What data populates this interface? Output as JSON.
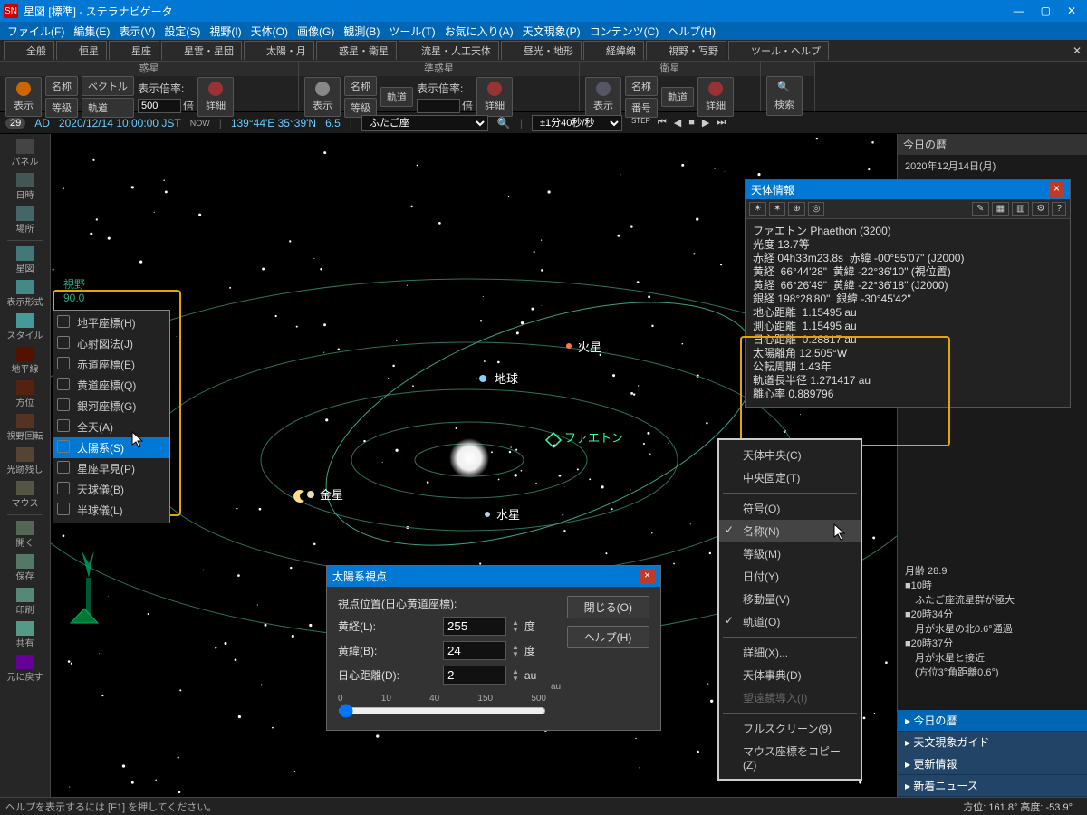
{
  "window_title": "星図 [標準] - ステラナビゲータ",
  "menus": [
    "ファイル(F)",
    "編集(E)",
    "表示(V)",
    "設定(S)",
    "視野(I)",
    "天体(O)",
    "画像(G)",
    "観測(B)",
    "ツール(T)",
    "お気に入り(A)",
    "天文現象(P)",
    "コンテンツ(C)",
    "ヘルプ(H)"
  ],
  "tabs": [
    "全般",
    "恒星",
    "星座",
    "星雲・星団",
    "太陽・月",
    "惑星・衛星",
    "流星・人工天体",
    "昼光・地形",
    "経緯線",
    "視野・写野",
    "ツール・ヘルプ"
  ],
  "tb": {
    "group1": "惑星",
    "group2": "準惑星",
    "group3": "衛星",
    "show": "表示",
    "name": "名称",
    "mag": "等級",
    "vector": "ベクトル",
    "orbit": "軌道",
    "number": "番号",
    "scale_label": "表示倍率:",
    "scale_value": "500",
    "bai": "倍",
    "detail": "詳細",
    "search": "検索"
  },
  "timebar": {
    "badge": "29",
    "ad": "AD",
    "datetime": "2020/12/14 10:00:00 JST",
    "now": "NOW",
    "lonlat": "139°44'E 35°39'N",
    "fov": "6.5",
    "constellation": "ふたご座",
    "step": "±1分40秒/秒"
  },
  "leftpanel": [
    "パネル",
    "日時",
    "場所",
    "星図",
    "表示形式",
    "スタイル",
    "地平線",
    "方位",
    "視野回転",
    "光跡残し",
    "マウス",
    "開く",
    "保存",
    "印刷",
    "共有",
    "元に戻す"
  ],
  "fov_label": "視野",
  "fov_val": "90.0",
  "coord_menu": {
    "items": [
      "地平座標(H)",
      "心射図法(J)",
      "赤道座標(E)",
      "黄道座標(Q)",
      "銀河座標(G)",
      "全天(A)",
      "太陽系(S)",
      "星座早見(P)",
      "天球儀(B)",
      "半球儀(L)"
    ],
    "selected": 6
  },
  "sky_labels": {
    "mars": "火星",
    "earth": "地球",
    "mercury": "水星",
    "venus": "金星",
    "phaethon": "ファエトン"
  },
  "info": {
    "title": "天体情報",
    "lines": [
      "ファエトン Phaethon (3200)",
      "光度 13.7等",
      "赤経 04h33m23.8s  赤緯 -00°55'07\" (J2000)",
      "黄経  66°44'28\"  黄緯 -22°36'10\" (視位置)",
      "黄経  66°26'49\"  黄緯 -22°36'18\" (J2000)",
      "銀経 198°28'80\"  銀緯 -30°45'42\"",
      "地心距離  1.15495 au",
      "測心距離  1.15495 au",
      "日心距離  0.28817 au",
      "太陽離角 12.505°W",
      "公転周期 1.43年",
      "軌道長半径 1.271417 au",
      "離心率 0.889796"
    ]
  },
  "ctx2": {
    "items": [
      "天体中央(C)",
      "中央固定(T)",
      "符号(O)",
      "名称(N)",
      "等級(M)",
      "日付(Y)",
      "移動量(V)",
      "軌道(O)",
      "詳細(X)...",
      "天体事典(D)",
      "望遠鏡導入(I)",
      "フルスクリーン(9)",
      "マウス座標をコピー(Z)"
    ],
    "checked": [
      3,
      7
    ],
    "disabled": [
      10
    ],
    "selected": 3
  },
  "dlg": {
    "title": "太陽系視点",
    "caption": "視点位置(日心黄道座標):",
    "lon_label": "黄経(L):",
    "lon": "255",
    "lon_unit": "度",
    "lat_label": "黄緯(B):",
    "lat": "24",
    "lat_unit": "度",
    "dist_label": "日心距離(D):",
    "dist": "2",
    "dist_unit": "au",
    "ticks": [
      "0",
      "10",
      "40",
      "150",
      "500"
    ],
    "tick_unit": "au",
    "close_btn": "閉じる(O)",
    "help_btn": "ヘルプ(H)"
  },
  "rcol": {
    "hdr": "今日の暦",
    "date": "2020年12月14日(月)",
    "moon_age": "月齢 28.9",
    "events": [
      "■10時",
      "　ふたご座流星群が極大",
      "■20時34分",
      "　月が水星の北0.6°通過",
      "■20時37分",
      "　月が水星と接近",
      "　(方位3°角距離0.6°)"
    ],
    "links": [
      "今日の暦",
      "天文現象ガイド",
      "更新情報",
      "新着ニュース"
    ]
  },
  "status": {
    "hint": "ヘルプを表示するには [F1] を押してください。",
    "coords": "方位: 161.8° 高度: -53.9°"
  }
}
